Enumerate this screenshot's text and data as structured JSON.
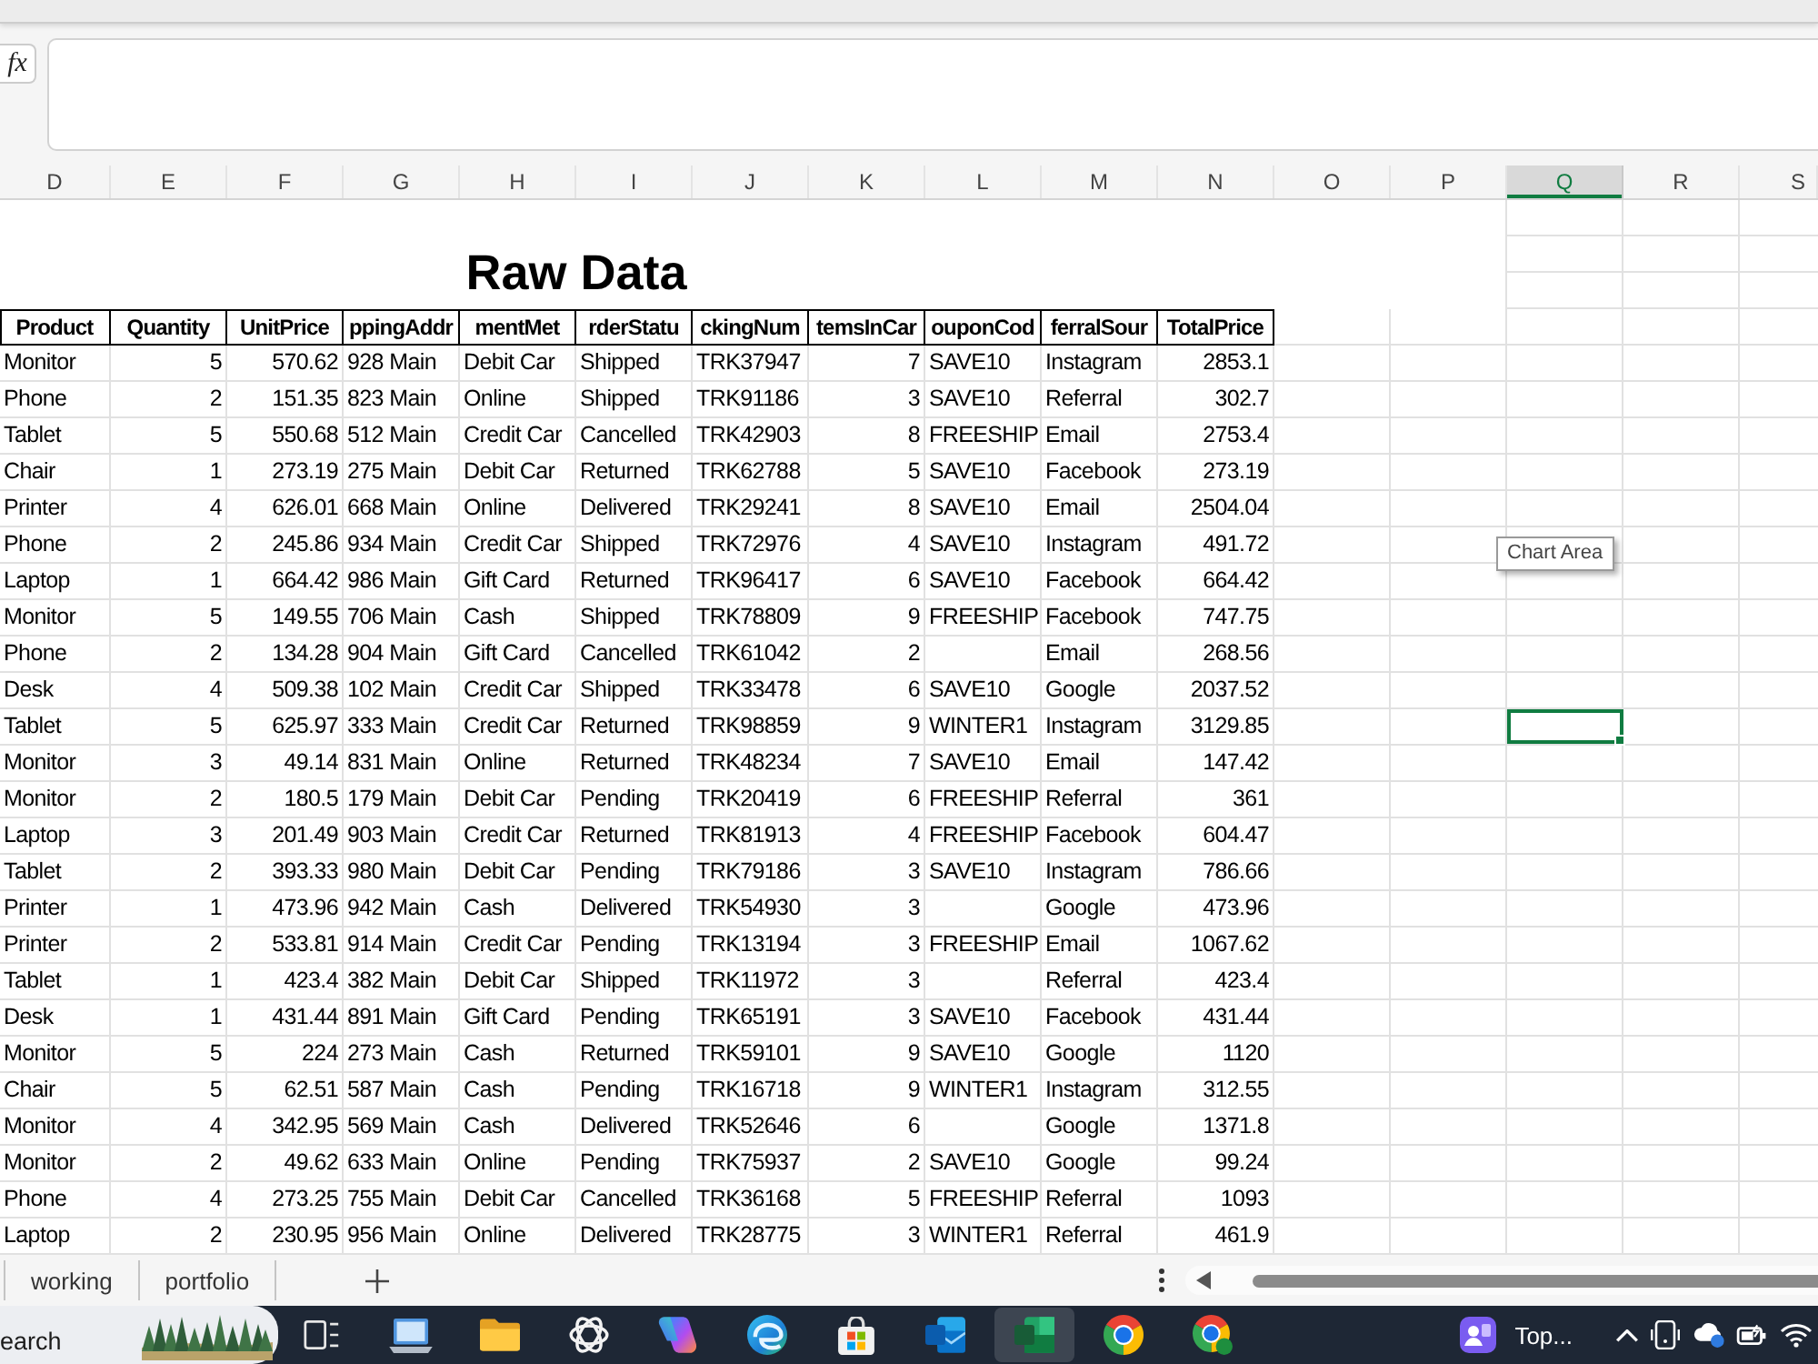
{
  "formula_bar": {
    "function_button": "fx"
  },
  "column_letters": [
    {
      "label": "D",
      "selected": false
    },
    {
      "label": "E",
      "selected": false
    },
    {
      "label": "F",
      "selected": false
    },
    {
      "label": "G",
      "selected": false
    },
    {
      "label": "H",
      "selected": false
    },
    {
      "label": "I",
      "selected": false
    },
    {
      "label": "J",
      "selected": false
    },
    {
      "label": "K",
      "selected": false
    },
    {
      "label": "L",
      "selected": false
    },
    {
      "label": "M",
      "selected": false
    },
    {
      "label": "N",
      "selected": false
    },
    {
      "label": "O",
      "selected": false
    },
    {
      "label": "P",
      "selected": false
    },
    {
      "label": "Q",
      "selected": true
    },
    {
      "label": "R",
      "selected": false
    },
    {
      "label": "S",
      "selected": false
    }
  ],
  "sheet": {
    "title": "Raw Data",
    "columns": [
      {
        "label": "Product",
        "kind": "text"
      },
      {
        "label": "Quantity",
        "kind": "number"
      },
      {
        "label": "UnitPrice",
        "kind": "number"
      },
      {
        "label": "ppingAddr",
        "kind": "text"
      },
      {
        "label": "mentMet",
        "kind": "text"
      },
      {
        "label": "rderStatu",
        "kind": "text"
      },
      {
        "label": "ckingNum",
        "kind": "text"
      },
      {
        "label": "temsInCar",
        "kind": "number"
      },
      {
        "label": "ouponCod",
        "kind": "text"
      },
      {
        "label": "ferralSour",
        "kind": "text"
      },
      {
        "label": "TotalPrice",
        "kind": "number"
      }
    ],
    "rows": [
      {
        "cells": [
          "Monitor",
          "5",
          "570.62",
          "928 Main",
          "Debit Car",
          "Shipped",
          "TRK37947",
          "7",
          "SAVE10",
          "Instagram",
          "2853.1"
        ],
        "active_cell": false
      },
      {
        "cells": [
          "Phone",
          "2",
          "151.35",
          "823 Main",
          "Online",
          "Shipped",
          "TRK91186",
          "3",
          "SAVE10",
          "Referral",
          "302.7"
        ],
        "active_cell": false
      },
      {
        "cells": [
          "Tablet",
          "5",
          "550.68",
          "512 Main",
          "Credit Car",
          "Cancelled",
          "TRK42903",
          "8",
          "FREESHIP",
          "Email",
          "2753.4"
        ],
        "active_cell": false
      },
      {
        "cells": [
          "Chair",
          "1",
          "273.19",
          "275 Main",
          "Debit Car",
          "Returned",
          "TRK62788",
          "5",
          "SAVE10",
          "Facebook",
          "273.19"
        ],
        "active_cell": false
      },
      {
        "cells": [
          "Printer",
          "4",
          "626.01",
          "668 Main",
          "Online",
          "Delivered",
          "TRK29241",
          "8",
          "SAVE10",
          "Email",
          "2504.04"
        ],
        "active_cell": false
      },
      {
        "cells": [
          "Phone",
          "2",
          "245.86",
          "934 Main",
          "Credit Car",
          "Shipped",
          "TRK72976",
          "4",
          "SAVE10",
          "Instagram",
          "491.72"
        ],
        "active_cell": false
      },
      {
        "cells": [
          "Laptop",
          "1",
          "664.42",
          "986 Main",
          "Gift Card",
          "Returned",
          "TRK96417",
          "6",
          "SAVE10",
          "Facebook",
          "664.42"
        ],
        "active_cell": false
      },
      {
        "cells": [
          "Monitor",
          "5",
          "149.55",
          "706 Main",
          "Cash",
          "Shipped",
          "TRK78809",
          "9",
          "FREESHIP",
          "Facebook",
          "747.75"
        ],
        "active_cell": false
      },
      {
        "cells": [
          "Phone",
          "2",
          "134.28",
          "904 Main",
          "Gift Card",
          "Cancelled",
          "TRK61042",
          "2",
          null,
          "Email",
          "268.56"
        ],
        "active_cell": false
      },
      {
        "cells": [
          "Desk",
          "4",
          "509.38",
          "102 Main",
          "Credit Car",
          "Shipped",
          "TRK33478",
          "6",
          "SAVE10",
          "Google",
          "2037.52"
        ],
        "active_cell": false
      },
      {
        "cells": [
          "Tablet",
          "5",
          "625.97",
          "333 Main",
          "Credit Car",
          "Returned",
          "TRK98859",
          "9",
          "WINTER1",
          "Instagram",
          "3129.85"
        ],
        "active_cell": true
      },
      {
        "cells": [
          "Monitor",
          "3",
          "49.14",
          "831 Main",
          "Online",
          "Returned",
          "TRK48234",
          "7",
          "SAVE10",
          "Email",
          "147.42"
        ],
        "active_cell": false
      },
      {
        "cells": [
          "Monitor",
          "2",
          "180.5",
          "179 Main",
          "Debit Car",
          "Pending",
          "TRK20419",
          "6",
          "FREESHIP",
          "Referral",
          "361"
        ],
        "active_cell": false
      },
      {
        "cells": [
          "Laptop",
          "3",
          "201.49",
          "903 Main",
          "Credit Car",
          "Returned",
          "TRK81913",
          "4",
          "FREESHIP",
          "Facebook",
          "604.47"
        ],
        "active_cell": false
      },
      {
        "cells": [
          "Tablet",
          "2",
          "393.33",
          "980 Main",
          "Debit Car",
          "Pending",
          "TRK79186",
          "3",
          "SAVE10",
          "Instagram",
          "786.66"
        ],
        "active_cell": false
      },
      {
        "cells": [
          "Printer",
          "1",
          "473.96",
          "942 Main",
          "Cash",
          "Delivered",
          "TRK54930",
          "3",
          null,
          "Google",
          "473.96"
        ],
        "active_cell": false
      },
      {
        "cells": [
          "Printer",
          "2",
          "533.81",
          "914 Main",
          "Credit Car",
          "Pending",
          "TRK13194",
          "3",
          "FREESHIP",
          "Email",
          "1067.62"
        ],
        "active_cell": false
      },
      {
        "cells": [
          "Tablet",
          "1",
          "423.4",
          "382 Main",
          "Debit Car",
          "Shipped",
          "TRK11972",
          "3",
          null,
          "Referral",
          "423.4"
        ],
        "active_cell": false
      },
      {
        "cells": [
          "Desk",
          "1",
          "431.44",
          "891 Main",
          "Gift Card",
          "Pending",
          "TRK65191",
          "3",
          "SAVE10",
          "Facebook",
          "431.44"
        ],
        "active_cell": false
      },
      {
        "cells": [
          "Monitor",
          "5",
          "224",
          "273 Main",
          "Cash",
          "Returned",
          "TRK59101",
          "9",
          "SAVE10",
          "Google",
          "1120"
        ],
        "active_cell": false
      },
      {
        "cells": [
          "Chair",
          "5",
          "62.51",
          "587 Main",
          "Cash",
          "Pending",
          "TRK16718",
          "9",
          "WINTER1",
          "Instagram",
          "312.55"
        ],
        "active_cell": false
      },
      {
        "cells": [
          "Monitor",
          "4",
          "342.95",
          "569 Main",
          "Cash",
          "Delivered",
          "TRK52646",
          "6",
          null,
          "Google",
          "1371.8"
        ],
        "active_cell": false
      },
      {
        "cells": [
          "Monitor",
          "2",
          "49.62",
          "633 Main",
          "Online",
          "Pending",
          "TRK75937",
          "2",
          "SAVE10",
          "Google",
          "99.24"
        ],
        "active_cell": false
      },
      {
        "cells": [
          "Phone",
          "4",
          "273.25",
          "755 Main",
          "Debit Car",
          "Cancelled",
          "TRK36168",
          "5",
          "FREESHIP",
          "Referral",
          "1093"
        ],
        "active_cell": false
      },
      {
        "cells": [
          "Laptop",
          "2",
          "230.95",
          "956 Main",
          "Online",
          "Delivered",
          "TRK28775",
          "3",
          "WINTER1",
          "Referral",
          "461.9"
        ],
        "active_cell": false
      }
    ]
  },
  "tooltip": {
    "text": "Chart Area"
  },
  "sheet_tabs": [
    {
      "label": "working",
      "selected": false
    },
    {
      "label": "portfolio",
      "selected": false
    }
  ],
  "taskbar": {
    "search": {
      "placeholder": "earch"
    },
    "apps": [
      {
        "kind": "task_view",
        "active": false
      },
      {
        "kind": "laptop",
        "active": false
      },
      {
        "kind": "folder",
        "active": false
      },
      {
        "kind": "knot",
        "active": false
      },
      {
        "kind": "ribbon",
        "active": false
      },
      {
        "kind": "wave",
        "active": false
      },
      {
        "kind": "store",
        "active": false
      },
      {
        "kind": "mail",
        "active": false
      },
      {
        "kind": "spreadsheet",
        "active": true
      },
      {
        "kind": "browser",
        "active": false
      },
      {
        "kind": "browser_profile",
        "active": false
      }
    ],
    "tray_app": {
      "label": "Top..."
    }
  }
}
